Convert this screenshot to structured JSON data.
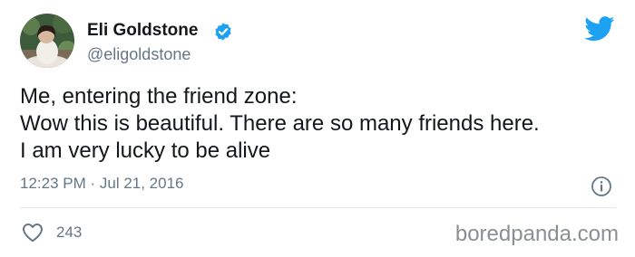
{
  "author": {
    "display_name": "Eli Goldstone",
    "handle": "@eligoldstone",
    "verified": true,
    "avatar": "avatar-photo"
  },
  "tweet": {
    "lines": [
      "Me, entering the friend zone:",
      "Wow this is beautiful. There are so many friends here.",
      "I am very lucky to be alive"
    ],
    "timestamp": "12:23 PM · Jul 21, 2016"
  },
  "actions": {
    "like_icon": "heart-icon",
    "like_count": "243",
    "info_icon": "info-icon"
  },
  "branding": {
    "platform_icon": "twitter-bird-icon",
    "watermark": "boredpanda.com"
  },
  "colors": {
    "accent": "#1da1f2",
    "text_primary": "#14171a",
    "text_secondary": "#657786",
    "divider": "#e1e8ed"
  }
}
